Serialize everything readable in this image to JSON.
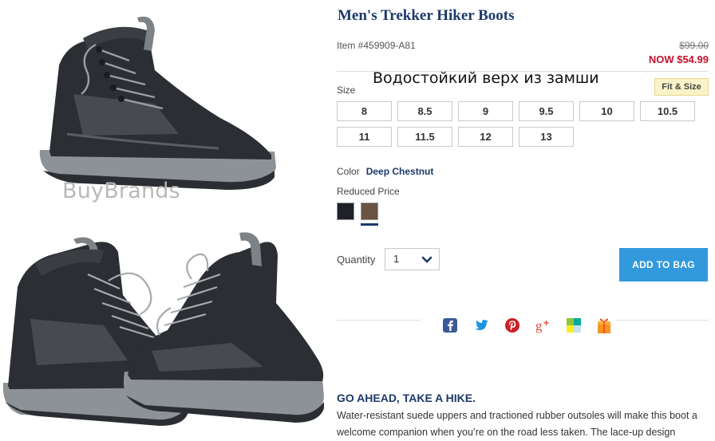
{
  "watermark": "BuyBrands",
  "product": {
    "title": "Men's Trekker Hiker Boots",
    "item_number": "Item #459909-A81",
    "price_original": "$99.00",
    "price_now": "NOW $54.99",
    "overlay_caption": "Водостойкий верх из замши"
  },
  "size": {
    "label": "Size",
    "fit_link": "Fit & Size",
    "options": [
      "8",
      "8.5",
      "9",
      "9.5",
      "10",
      "10.5",
      "11",
      "11.5",
      "12",
      "13"
    ]
  },
  "color": {
    "label": "Color",
    "selected": "Deep Chestnut",
    "price_group": "Reduced Price",
    "swatches": [
      {
        "name": "black",
        "hex": "#1e2126"
      },
      {
        "name": "deep-chestnut",
        "hex": "#6a5444"
      }
    ]
  },
  "quantity": {
    "label": "Quantity",
    "value": "1"
  },
  "add_to_bag": "ADD TO BAG",
  "share_icons": [
    "facebook-icon",
    "twitter-icon",
    "pinterest-icon",
    "google-plus-icon",
    "wishlist-icon",
    "gift-icon"
  ],
  "colors": {
    "accent": "#1c3a6b",
    "sale": "#c8102e",
    "button": "#3399dd"
  },
  "description": {
    "heading": "GO AHEAD, TAKE A HIKE.",
    "body": "Water-resistant suede uppers and tractioned rubber outsoles will make this boot a welcome companion when you’re on the road less taken. The lace-up design"
  }
}
